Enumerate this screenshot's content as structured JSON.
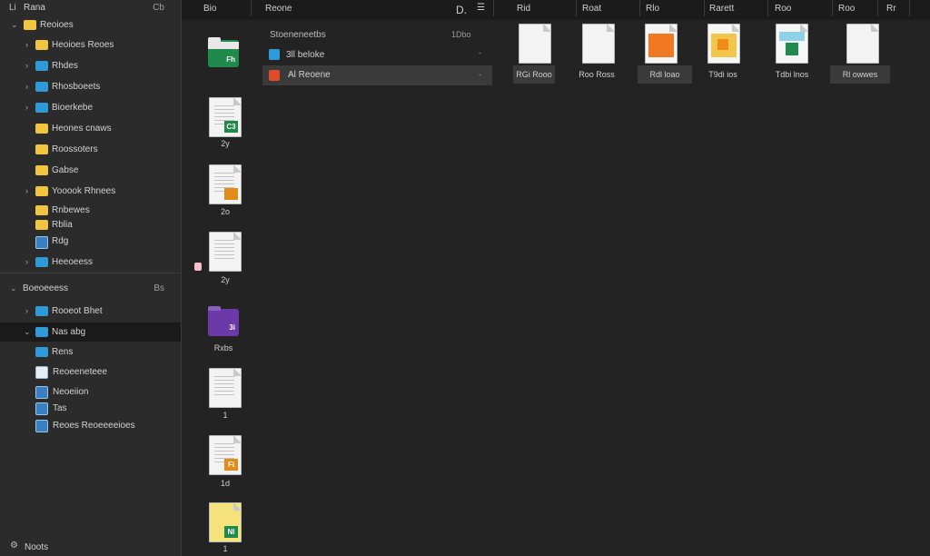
{
  "sidebar": {
    "header": {
      "title": "Rana",
      "count": "Cb"
    },
    "items": [
      {
        "label": "Reoioes",
        "color": "yellow"
      },
      {
        "label": "Heoioes Reoes",
        "color": "yellow"
      },
      {
        "label": "Rhdes",
        "color": "blue"
      },
      {
        "label": "Rhosboeets",
        "color": "blue"
      },
      {
        "label": "Bioerkebe",
        "color": "blue"
      },
      {
        "label": "Heones cnaws",
        "color": "yellow"
      },
      {
        "label": "Roossoters",
        "color": "yellow"
      },
      {
        "label": "Gabse",
        "color": "yellow"
      },
      {
        "label": "Yooook Rhnees",
        "color": "yellow"
      },
      {
        "label": "Rnbewes",
        "color": "yellow"
      },
      {
        "label": "Rblia",
        "color": "yellow"
      },
      {
        "label": "Rdg",
        "color": "img"
      },
      {
        "label": "Heeoeess",
        "color": "blue"
      }
    ],
    "section": {
      "label": "Boeoeeess",
      "count": "Bs"
    },
    "section_items": [
      {
        "label": "Rooeot Bhet",
        "color": "blue"
      },
      {
        "label": "Nas abg",
        "color": "blue"
      },
      {
        "label": "Rens",
        "color": "blue"
      },
      {
        "label": "Reoeeneteee",
        "color": "doc"
      },
      {
        "label": "Neoeiion",
        "color": "img"
      },
      {
        "label": "Tas",
        "color": "img"
      },
      {
        "label": "Reoes Reoeeeeioes",
        "color": "img"
      }
    ],
    "footer": {
      "label": "Noots"
    }
  },
  "topbar": {
    "col_a": "Bio",
    "col_b": "Reone",
    "col_b_aux": "D.",
    "cols": [
      "Rid",
      "Roat",
      "Rlo",
      "Rarett",
      "Roo",
      "Roo",
      "Rr"
    ]
  },
  "column1": {
    "items": [
      {
        "label": "",
        "kind": "folder",
        "color": "#1f8a4c",
        "badge": "Fh"
      },
      {
        "label": "2y",
        "kind": "file",
        "badge_color": "#1f8a4c",
        "badge": "C3"
      },
      {
        "label": "2o",
        "kind": "file",
        "badge_color": "#e38b1a",
        "badge": ""
      },
      {
        "label": "2y",
        "kind": "file",
        "badge_color": "",
        "badge": ""
      },
      {
        "label": "Rxbs",
        "kind": "folder",
        "color": "#6b3aa8",
        "badge": "3i"
      },
      {
        "label": "1",
        "kind": "file",
        "badge_color": "",
        "badge": ""
      },
      {
        "label": "1d",
        "kind": "file",
        "badge_color": "#e38b1a",
        "badge": "Fi"
      },
      {
        "label": "1",
        "kind": "file",
        "badge_color": "#1f8a4c",
        "badge": "Nl"
      }
    ]
  },
  "list": {
    "header": {
      "label": "Stoeneneetbs",
      "aux": "1Dbo"
    },
    "rows": [
      {
        "label": "3ll beloke",
        "aux": "-",
        "color": "#2e9bd8"
      },
      {
        "label": "Al Reoene",
        "aux": "-",
        "color": "#e14a2a"
      }
    ]
  },
  "grid": {
    "files": [
      {
        "label": "RGi Rooo",
        "badge_color": "",
        "fill": "#f3f3f3"
      },
      {
        "label": "Roo Ross",
        "badge_color": "",
        "fill": "#f3f3f3"
      },
      {
        "label": "Rdl loao",
        "badge_color": "#e36a1a",
        "fill": "#f09a35"
      },
      {
        "label": "T9di ios",
        "badge_color": "#e8a21a",
        "fill": "#f3c64a"
      },
      {
        "label": "Tdbi lnos",
        "badge_color": "#1f8a4c",
        "fill": "#8fd1e8"
      },
      {
        "label": "Rl owwes",
        "badge_color": "",
        "fill": "#f3f3f3"
      }
    ]
  },
  "accent": "#2e9bd8"
}
